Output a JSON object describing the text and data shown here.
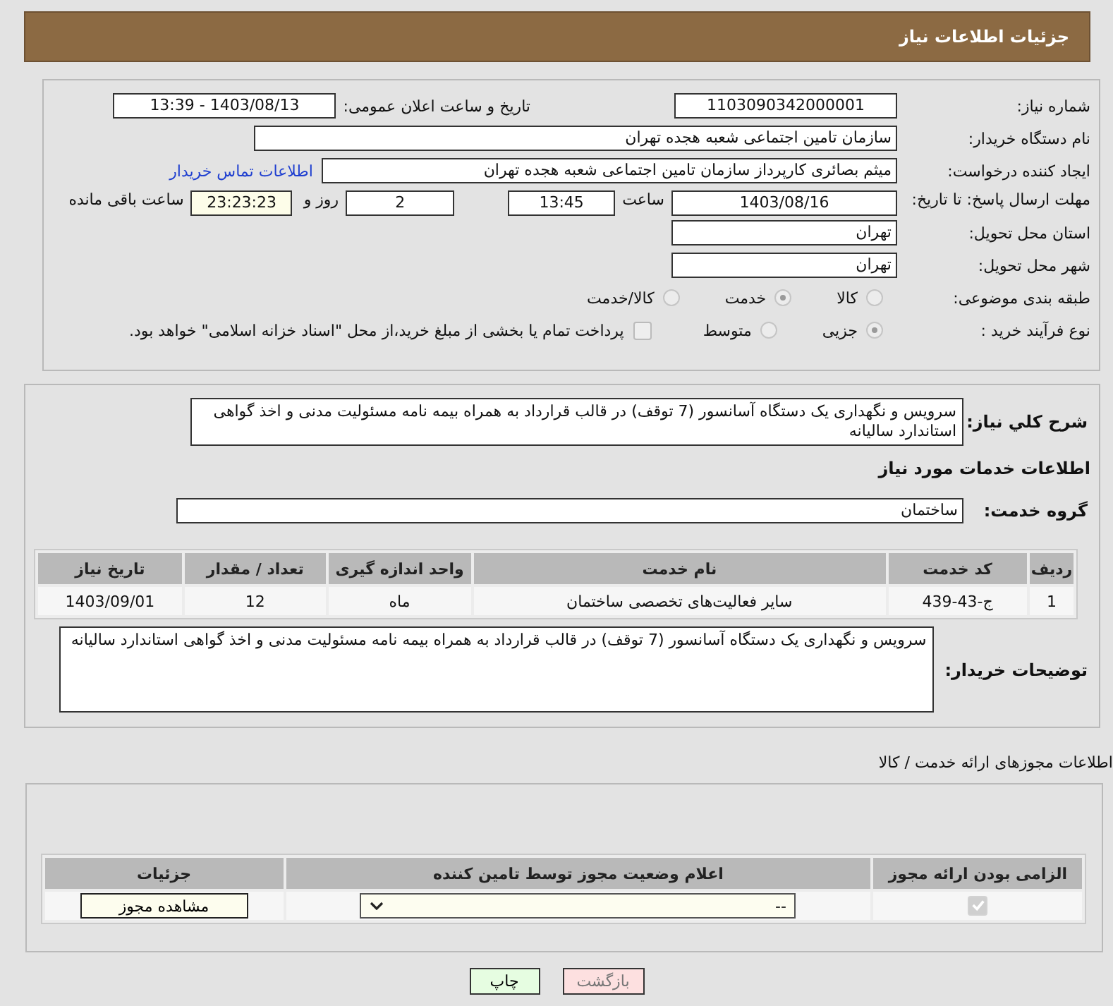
{
  "header": {
    "title": "جزئیات اطلاعات نیاز"
  },
  "need_number": {
    "label": "شماره نیاز:",
    "value": "1103090342000001"
  },
  "announce": {
    "label": "تاریخ و ساعت اعلان عمومی:",
    "value": "1403/08/13 - 13:39"
  },
  "buyer_org": {
    "label": "نام دستگاه خریدار:",
    "value": "سازمان تامین اجتماعی شعبه هجده تهران"
  },
  "requester": {
    "label": "ایجاد کننده درخواست:",
    "value": "میثم بصائری کارپرداز سازمان تامین اجتماعی شعبه هجده تهران",
    "link": "اطلاعات تماس خریدار"
  },
  "deadline": {
    "label": "مهلت ارسال پاسخ: تا تاریخ:",
    "date": "1403/08/16",
    "time_label": "ساعت",
    "time": "13:45",
    "days": "2",
    "days_label": "روز و",
    "remaining": "23:23:23",
    "remaining_label": "ساعت باقی مانده"
  },
  "province": {
    "label": "استان محل تحویل:",
    "value": "تهران"
  },
  "city": {
    "label": "شهر محل تحویل:",
    "value": "تهران"
  },
  "category": {
    "label": "طبقه بندی موضوعی:",
    "options": [
      {
        "label": "کالا",
        "selected": false
      },
      {
        "label": "خدمت",
        "selected": true
      },
      {
        "label": "کالا/خدمت",
        "selected": false
      }
    ]
  },
  "process": {
    "label": "نوع فرآیند خرید :",
    "options": [
      {
        "label": "جزیی",
        "selected": true
      },
      {
        "label": "متوسط",
        "selected": false
      }
    ],
    "payment": {
      "checked": false,
      "text": "پرداخت تمام یا بخشی از مبلغ خرید،از محل \"اسناد خزانه اسلامی\" خواهد بود."
    }
  },
  "summary": {
    "label": "شرح کلي نیاز:",
    "value": "سرویس و نگهداری یک دستگاه آسانسور (7 توقف) در قالب قرارداد به همراه بیمه نامه مسئولیت مدنی و اخذ گواهی استاندارد سالیانه"
  },
  "services_title": "اطلاعات خدمات مورد نیاز",
  "service_group": {
    "label": "گروه خدمت:",
    "value": "ساختمان"
  },
  "services_table": {
    "columns": [
      "ردیف",
      "کد خدمت",
      "نام خدمت",
      "واحد اندازه گیری",
      "تعداد / مقدار",
      "تاریخ نیاز"
    ],
    "rows": [
      [
        "1",
        "ج-43-439",
        "سایر فعالیت‌های تخصصی ساختمان",
        "ماه",
        "12",
        "1403/09/01"
      ]
    ]
  },
  "buyer_notes": {
    "label": "توضیحات خریدار:",
    "value": "سرویس و نگهداری یک دستگاه آسانسور (7 توقف) در قالب قرارداد به همراه بیمه نامه مسئولیت مدنی و اخذ گواهی استاندارد سالیانه"
  },
  "permits_title": "اطلاعات مجوزهای ارائه خدمت / کالا",
  "permits_table": {
    "columns": [
      "الزامی بودن ارائه مجوز",
      "اعلام وضعیت مجوز توسط تامین کننده",
      "جزئیات"
    ],
    "rows": [
      {
        "required": true,
        "status": "--",
        "action": "مشاهده مجوز"
      }
    ]
  },
  "buttons": [
    {
      "label": "بازگشت",
      "kind": "back"
    },
    {
      "label": "چاپ",
      "kind": "print"
    }
  ]
}
